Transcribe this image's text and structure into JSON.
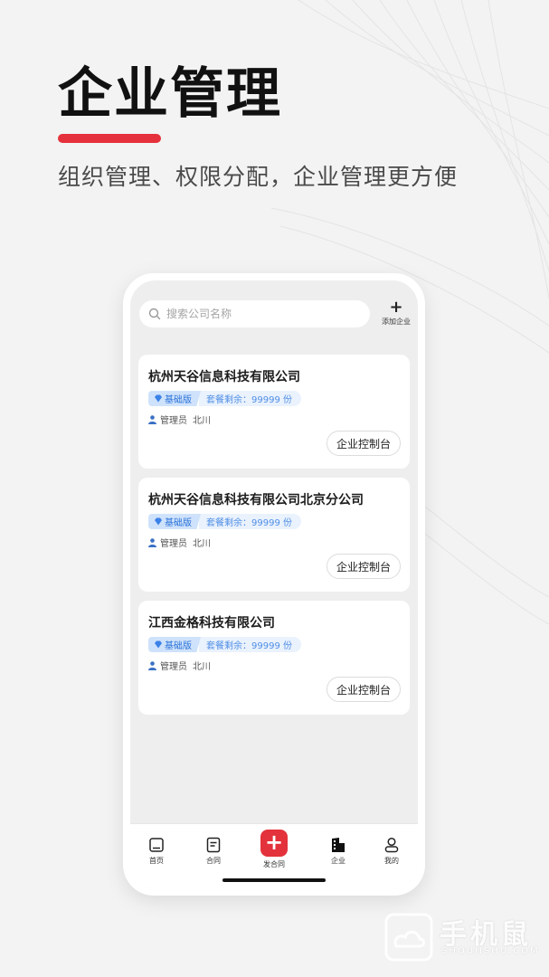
{
  "hero": {
    "title": "企业管理",
    "subtitle": "组织管理、权限分配，企业管理更方便",
    "accent_color": "#e5313b"
  },
  "search": {
    "placeholder": "搜索公司名称",
    "icon": "search-icon"
  },
  "add_company": {
    "icon": "plus-icon",
    "label": "添加企业"
  },
  "companies": [
    {
      "name": "杭州天谷信息科技有限公司",
      "plan": "基础版",
      "remaining": "套餐剩余：99999 份",
      "admin_label": "管理员",
      "admin_name": "北川",
      "action": "企业控制台"
    },
    {
      "name": "杭州天谷信息科技有限公司北京分公司",
      "plan": "基础版",
      "remaining": "套餐剩余：99999 份",
      "admin_label": "管理员",
      "admin_name": "北川",
      "action": "企业控制台"
    },
    {
      "name": "江西金格科技有限公司",
      "plan": "基础版",
      "remaining": "套餐剩余：99999 份",
      "admin_label": "管理员",
      "admin_name": "北川",
      "action": "企业控制台"
    }
  ],
  "tabbar": {
    "items": [
      {
        "label": "首页",
        "icon": "home-icon"
      },
      {
        "label": "合同",
        "icon": "contract-icon"
      },
      {
        "label": "发合同",
        "icon": "plus-icon"
      },
      {
        "label": "企业",
        "icon": "building-icon"
      },
      {
        "label": "我的",
        "icon": "profile-icon"
      }
    ],
    "active": "企业",
    "accent_color": "#e3323b"
  },
  "watermark": {
    "brand": "手机鼠",
    "site": "SHOUJISHU.COM"
  }
}
